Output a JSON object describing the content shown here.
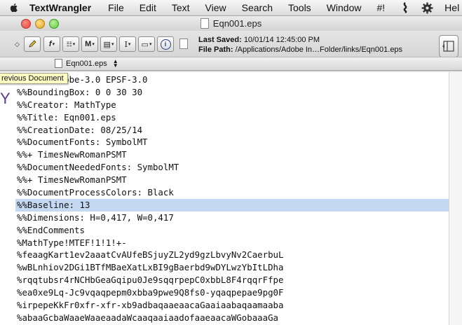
{
  "menubar": {
    "app_name": "TextWrangler",
    "items": [
      "File",
      "Edit",
      "Text",
      "View",
      "Search",
      "Tools",
      "Window",
      "#!"
    ],
    "help_partial": "Hel"
  },
  "window": {
    "title": "Eqn001.eps"
  },
  "toolbar": {
    "last_saved_label": "Last Saved:",
    "last_saved_value": "10/01/14 12:45:00 PM",
    "file_path_label": "File Path:",
    "file_path_value": "/Applications/Adobe In…Folder/links/Eqn001.eps"
  },
  "navbar": {
    "document_name": "Eqn001.eps"
  },
  "tooltip": {
    "text": "revious Document"
  },
  "editor": {
    "lines": [
      "ˇˇ%!PS-Adobe-3.0 EPSF-3.0",
      "%%BoundingBox: 0 0 30 30",
      "%%Creator: MathType",
      "%%Title: Eqn001.eps",
      "%%CreationDate: 08/25/14",
      "%%DocumentFonts: SymbolMT",
      "%%+ TimesNewRomanPSMT",
      "%%DocumentNeededFonts: SymbolMT",
      "%%+ TimesNewRomanPSMT",
      "%%DocumentProcessColors: Black",
      "%%Baseline: 13",
      "%%Dimensions: H=0,417, W=0,417",
      "%%EndComments",
      "%MathType!MTEF!1!1!+-",
      "%feaagKart1ev2aaatCvAUfeBSjuyZL2yd9gzLbvyNv2CaerbuL",
      "%wBLnhiov2DGi1BTfMBaeXatLxBI9gBaerbd9wDYLwzYbItLDha",
      "%rqqtubsr4rNCHbGeaGqipu0Je9sqqrpepC0xbbL8F4rqqrFfpe",
      "%ea0xe9Lq-Jc9vqaqpepm0xbba9pwe9Q8fs0-yqaqpepae9pg0F",
      "%irpepeKkFr0xfr-xfr-xb9adbaqaaeaacaGaaiaabaqaamaaba",
      "%abaaGcbaWaaeWaaeaadaWcaaqaaiaadofaaeaacaWGobaaaGa"
    ],
    "highlighted_line_index": 10,
    "left_fragment": "Y"
  },
  "colors": {
    "highlight": "#c5d8f2",
    "tooltip_bg": "#ffffc6"
  }
}
